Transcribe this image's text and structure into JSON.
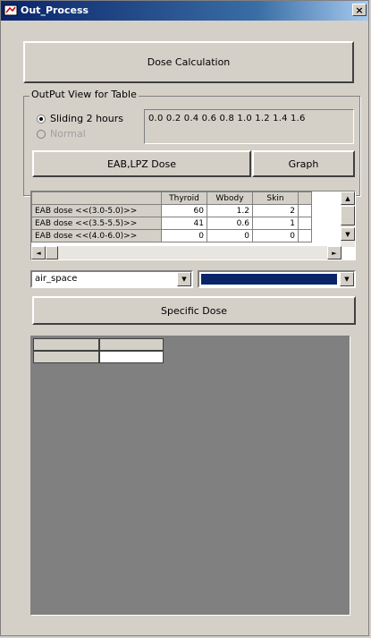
{
  "window": {
    "title": "Out_Process",
    "close_glyph": "×"
  },
  "buttons": {
    "dose_calculation": "Dose Calculation",
    "eab_lpz_dose": "EAB,LPZ Dose",
    "graph": "Graph",
    "specific_dose": "Specific Dose"
  },
  "output_group": {
    "label": "OutPut View for Table",
    "radio_sliding": "Sliding 2 hours",
    "radio_normal": "Normal",
    "sliding_selected": true,
    "scale": "0.0  0.2  0.4  0.6  0.8  1.0  1.2  1.4  1.6"
  },
  "table": {
    "columns": [
      "Thyroid",
      "Wbody",
      "Skin"
    ],
    "rows": [
      {
        "label": "EAB dose <<(3.0-5.0)>>",
        "values": [
          "60",
          "1.2",
          "2"
        ]
      },
      {
        "label": "EAB dose <<(3.5-5.5)>>",
        "values": [
          "41",
          "0.6",
          "1"
        ]
      },
      {
        "label": "EAB dose <<(4.0-6.0)>>",
        "values": [
          "0",
          "0",
          "0"
        ]
      }
    ]
  },
  "combos": {
    "location_value": "air_space",
    "selected_color": "#0a246a"
  },
  "icons": {
    "app": "app-icon",
    "arrow_up": "▲",
    "arrow_down": "▼",
    "arrow_left": "◄",
    "arrow_right": "►"
  }
}
